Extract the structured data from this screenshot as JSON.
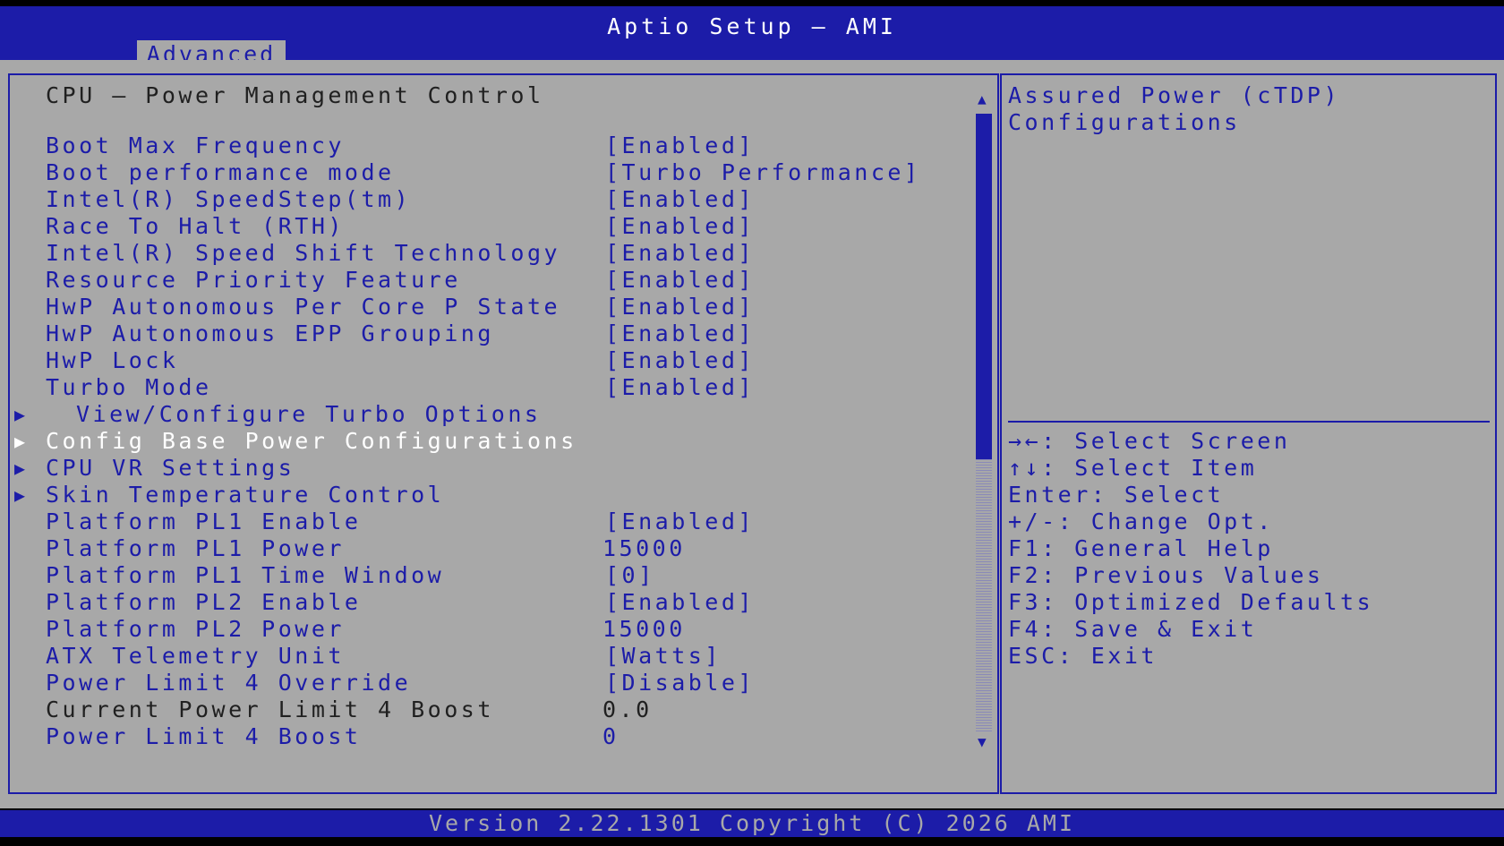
{
  "header": {
    "title": "Aptio Setup – AMI",
    "active_tab": "Advanced"
  },
  "page_title": "CPU – Power Management Control",
  "settings": [
    {
      "label": "Boot Max Frequency",
      "value": "[Enabled]"
    },
    {
      "label": "Boot performance mode",
      "value": "[Turbo Performance]"
    },
    {
      "label": "Intel(R) SpeedStep(tm)",
      "value": "[Enabled]"
    },
    {
      "label": "Race To Halt (RTH)",
      "value": "[Enabled]"
    },
    {
      "label": "Intel(R) Speed Shift Technology",
      "value": "[Enabled]"
    },
    {
      "label": "Resource Priority Feature",
      "value": "[Enabled]"
    },
    {
      "label": "HwP Autonomous Per Core P State",
      "value": "[Enabled]"
    },
    {
      "label": "HwP Autonomous EPP Grouping",
      "value": "[Enabled]"
    },
    {
      "label": "HwP Lock",
      "value": "[Enabled]"
    },
    {
      "label": "Turbo Mode",
      "value": "[Enabled]"
    }
  ],
  "submenus": [
    {
      "label": "View/Configure Turbo Options",
      "selected": false
    },
    {
      "label": "Config Base Power Configurations",
      "selected": true
    },
    {
      "label": "CPU VR Settings",
      "selected": false
    },
    {
      "label": "Skin Temperature Control",
      "selected": false
    }
  ],
  "settings2": [
    {
      "label": "Platform PL1 Enable",
      "value": "[Enabled]"
    },
    {
      "label": "Platform PL1 Power",
      "value": "15000"
    },
    {
      "label": "Platform PL1 Time Window",
      "value": "[0]"
    },
    {
      "label": "Platform PL2 Enable",
      "value": "[Enabled]"
    },
    {
      "label": "Platform PL2 Power",
      "value": "15000"
    },
    {
      "label": "ATX Telemetry Unit",
      "value": "[Watts]"
    },
    {
      "label": "Power Limit 4 Override",
      "value": "[Disable]"
    },
    {
      "label": "Current Power Limit 4 Boost",
      "value": "0.0",
      "readonly": true
    },
    {
      "label": "Power Limit 4 Boost",
      "value": "0"
    }
  ],
  "help": {
    "line1": "Assured Power (cTDP)",
    "line2": "Configurations"
  },
  "keys": [
    "→←: Select Screen",
    "↑↓: Select Item",
    "Enter: Select",
    "+/-: Change Opt.",
    "F1: General Help",
    "F2: Previous Values",
    "F3: Optimized Defaults",
    "F4: Save & Exit",
    "ESC: Exit"
  ],
  "scroll_fraction_visible": 0.56,
  "footer": "Version 2.22.1301 Copyright (C) 2026 AMI",
  "colors": {
    "bios_blue": "#1c1ca8",
    "bios_gray": "#a8a8a8",
    "selected_text": "#ffffff"
  },
  "icons": {
    "submenu": "triangle-right-icon",
    "scroll_up": "triangle-up-icon",
    "scroll_down": "triangle-down-icon"
  }
}
